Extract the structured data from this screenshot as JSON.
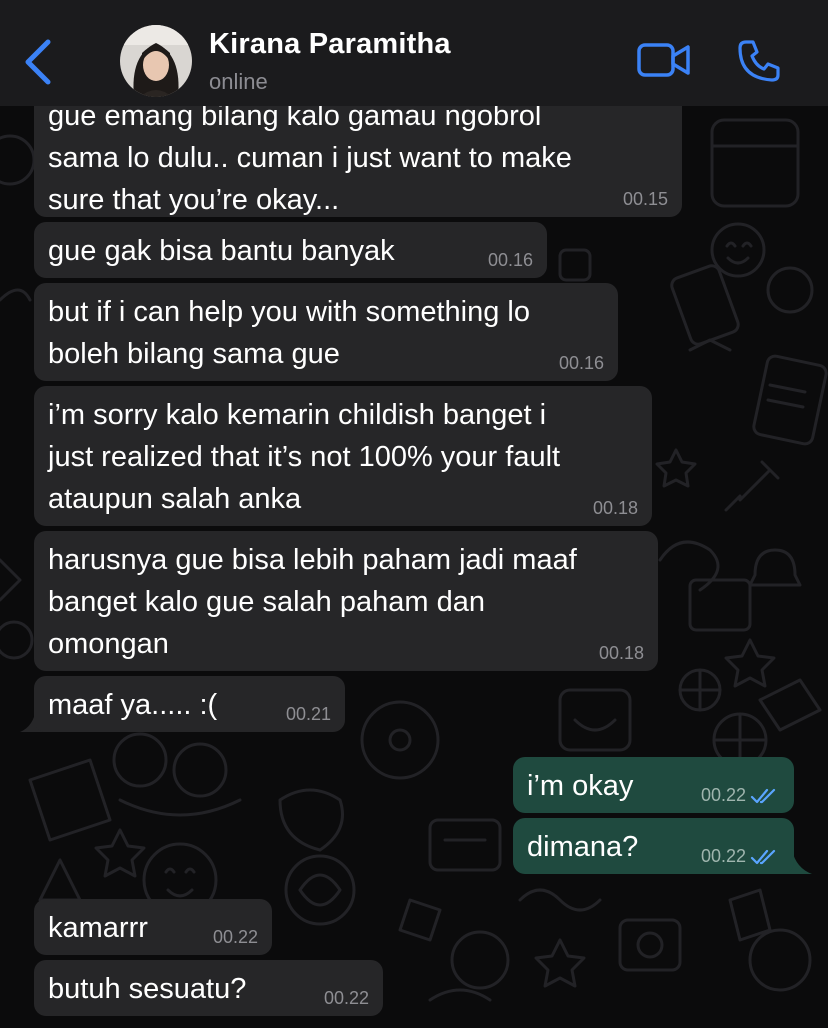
{
  "header": {
    "contact_name": "Kirana Paramitha",
    "status": "online",
    "icons": [
      "chevron-left-icon",
      "video-camera-icon",
      "phone-icon"
    ],
    "accent_color": "#3b82f6"
  },
  "messages": [
    {
      "direction": "incoming",
      "text": "gue emang bilang kalo gamau ngobrol\nsama lo dulu.. cuman i just want to make\nsure that you’re okay...",
      "time": "00.15"
    },
    {
      "direction": "incoming",
      "text": "gue gak bisa bantu banyak",
      "time": "00.16"
    },
    {
      "direction": "incoming",
      "text": "but if i can help you with something lo\nboleh bilang sama gue",
      "time": "00.16"
    },
    {
      "direction": "incoming",
      "text": "i’m sorry kalo kemarin childish banget i\njust realized that it’s not 100% your fault\nataupun salah anka",
      "time": "00.18"
    },
    {
      "direction": "incoming",
      "text": "harusnya gue bisa lebih paham jadi maaf\nbanget kalo gue salah paham dan\nomongan",
      "time": "00.18"
    },
    {
      "direction": "incoming",
      "text": "maaf ya..... :(",
      "time": "00.21"
    },
    {
      "direction": "outgoing",
      "text": "i’m okay",
      "time": "00.22",
      "status": "read"
    },
    {
      "direction": "outgoing",
      "text": "dimana?",
      "time": "00.22",
      "status": "read"
    },
    {
      "direction": "incoming",
      "text": "kamarrr",
      "time": "00.22"
    },
    {
      "direction": "incoming",
      "text": "butuh sesuatu?",
      "time": "00.22"
    }
  ],
  "colors": {
    "incoming_bubble": "#262628",
    "outgoing_bubble": "#1f4a3f",
    "read_ticks": "#5aa5ff"
  }
}
